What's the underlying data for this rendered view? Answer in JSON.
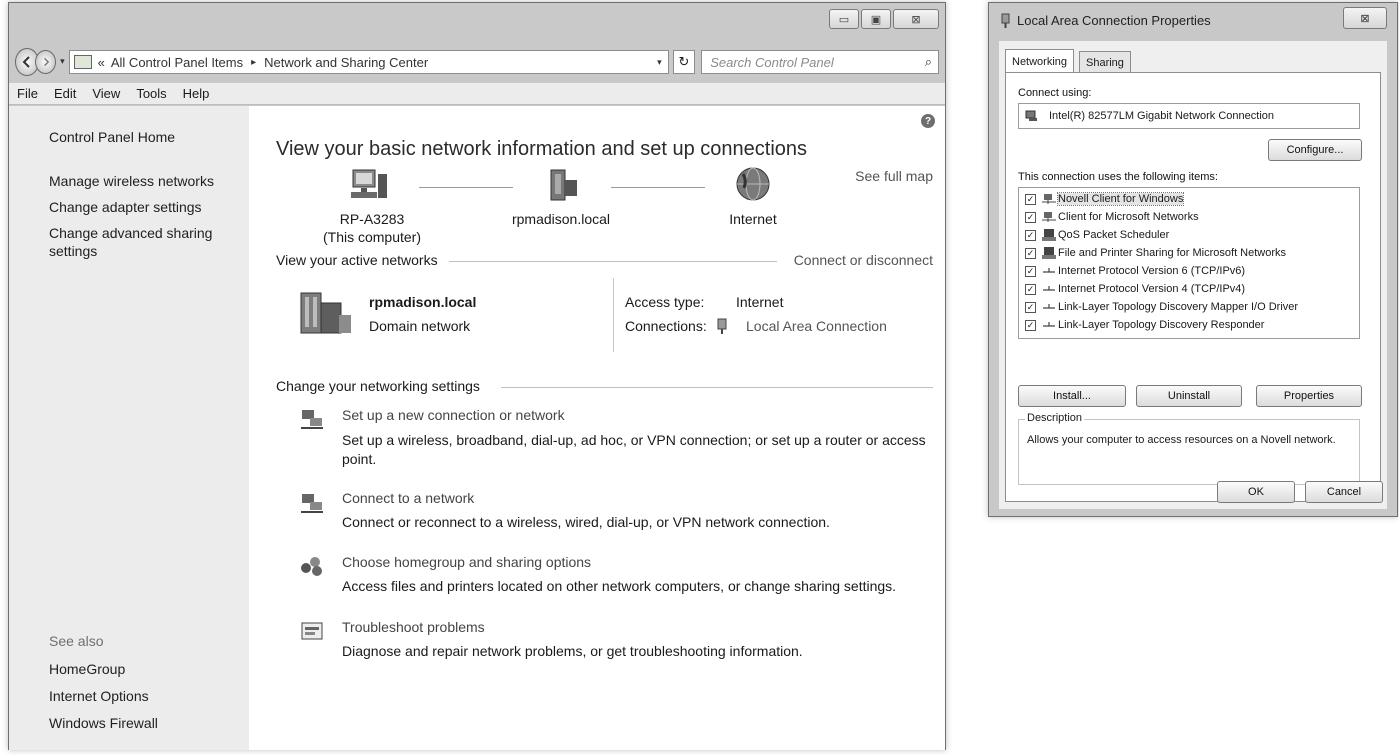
{
  "main_window": {
    "titlebar": {
      "minimize": "▭",
      "maximize": "▣",
      "close": "⊠"
    },
    "address": {
      "overflow": "«",
      "crumbs": [
        "All Control Panel Items",
        "Network and Sharing Center"
      ],
      "separator": "▸",
      "dropdown": "▾",
      "refresh": "↻"
    },
    "search": {
      "placeholder": "Search Control Panel",
      "icon": "⌕"
    },
    "menu": [
      "File",
      "Edit",
      "View",
      "Tools",
      "Help"
    ],
    "sidebar": {
      "home": "Control Panel Home",
      "links": [
        "Manage wireless networks",
        "Change adapter settings",
        "Change advanced sharing settings"
      ],
      "see_also_label": "See also",
      "see_also": [
        "HomeGroup",
        "Internet Options",
        "Windows Firewall"
      ]
    },
    "content": {
      "help": "?",
      "title": "View your basic network information and set up connections",
      "see_full_map": "See full map",
      "map": {
        "computer": {
          "name": "RP-A3283",
          "sub": "(This computer)",
          "icon": "computer-icon"
        },
        "network": {
          "name": "rpmadison.local",
          "icon": "network-icon"
        },
        "internet": {
          "name": "Internet",
          "icon": "globe-icon"
        }
      },
      "active_networks_header": "View your active networks",
      "connect_or_disconnect": "Connect or disconnect",
      "active_network": {
        "name": "rpmadison.local",
        "type": "Domain network",
        "access_type_label": "Access type:",
        "access_type_value": "Internet",
        "connections_label": "Connections:",
        "connections_value": "Local Area Connection"
      },
      "change_settings_header": "Change your networking settings",
      "tasks": [
        {
          "link": "Set up a new connection or network",
          "desc": "Set up a wireless, broadband, dial-up, ad hoc, or VPN connection; or set up a router or access point.",
          "icon": "new-connection-icon"
        },
        {
          "link": "Connect to a network",
          "desc": "Connect or reconnect to a wireless, wired, dial-up, or VPN network connection.",
          "icon": "connect-network-icon"
        },
        {
          "link": "Choose homegroup and sharing options",
          "desc": "Access files and printers located on other network computers, or change sharing settings.",
          "icon": "homegroup-icon"
        },
        {
          "link": "Troubleshoot problems",
          "desc": "Diagnose and repair network problems, or get troubleshooting information.",
          "icon": "troubleshoot-icon"
        }
      ]
    }
  },
  "dialog": {
    "title": "Local Area Connection Properties",
    "close": "⊠",
    "tabs": [
      "Networking",
      "Sharing"
    ],
    "connect_using_label": "Connect using:",
    "adapter": "Intel(R) 82577LM Gigabit Network Connection",
    "configure_button": "Configure...",
    "items_label": "This connection uses the following items:",
    "check": "✓",
    "items": [
      {
        "label": "Novell Client for Windows",
        "checked": true,
        "icon": "client-icon"
      },
      {
        "label": "Client for Microsoft Networks",
        "checked": true,
        "icon": "client-icon"
      },
      {
        "label": "QoS Packet Scheduler",
        "checked": true,
        "icon": "service-icon"
      },
      {
        "label": "File and Printer Sharing for Microsoft Networks",
        "checked": true,
        "icon": "service-icon"
      },
      {
        "label": "Internet Protocol Version 6 (TCP/IPv6)",
        "checked": true,
        "icon": "protocol-icon"
      },
      {
        "label": "Internet Protocol Version 4 (TCP/IPv4)",
        "checked": true,
        "icon": "protocol-icon"
      },
      {
        "label": "Link-Layer Topology Discovery Mapper I/O Driver",
        "checked": true,
        "icon": "protocol-icon"
      },
      {
        "label": "Link-Layer Topology Discovery Responder",
        "checked": true,
        "icon": "protocol-icon"
      }
    ],
    "buttons": {
      "install": "Install...",
      "uninstall": "Uninstall",
      "properties": "Properties"
    },
    "description_label": "Description",
    "description": "Allows your computer to access resources on a Novell network.",
    "ok": "OK",
    "cancel": "Cancel"
  }
}
